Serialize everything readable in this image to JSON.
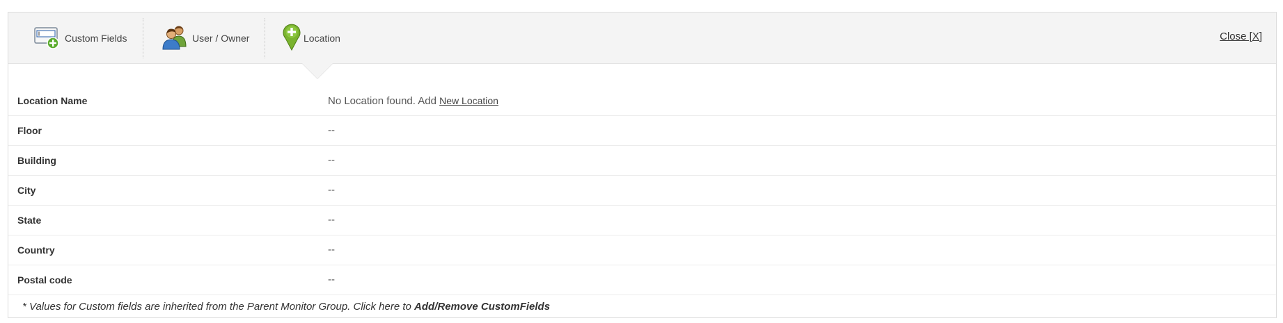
{
  "tabs": [
    {
      "label": "Custom Fields",
      "icon": "custom-fields-icon"
    },
    {
      "label": "User / Owner",
      "icon": "users-icon"
    },
    {
      "label": "Location",
      "icon": "location-pin-icon"
    }
  ],
  "close_label": "Close [X]",
  "location": {
    "rows": [
      {
        "label": "Location Name",
        "value_prefix": "No Location found. Add",
        "link": "New Location"
      },
      {
        "label": "Floor",
        "value": "--"
      },
      {
        "label": "Building",
        "value": "--"
      },
      {
        "label": "City",
        "value": "--"
      },
      {
        "label": "State",
        "value": "--"
      },
      {
        "label": "Country",
        "value": "--"
      },
      {
        "label": "Postal code",
        "value": "--"
      }
    ]
  },
  "footnote": {
    "text": "*  Values for Custom fields are inherited from the Parent Monitor Group. Click here to ",
    "link": "Add/Remove CustomFields"
  },
  "colors": {
    "tabbar_bg": "#f4f4f4",
    "pin_green": "#7ab32e",
    "text": "#333333"
  }
}
